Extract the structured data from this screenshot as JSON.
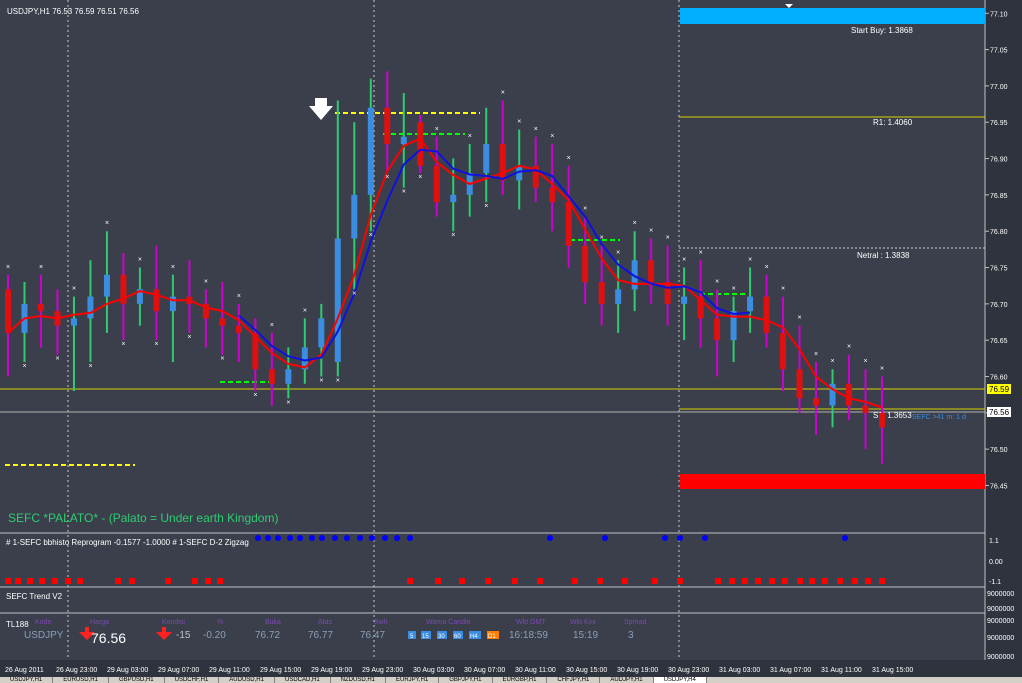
{
  "window": {
    "symbol_header": "USDJPY,H1 76.53 76.59 76.51 76.56"
  },
  "colors": {
    "background": "#3a3f4b",
    "bull": "#3a8de0",
    "bear": "#e01010",
    "wick_bull": "#2ecc71",
    "wick_bear": "#d000d0",
    "ma_red": "#ff0000",
    "ma_blue": "#0000ff",
    "level_yellow": "#ffff00",
    "level_green": "#00ff00",
    "start_buy_bar": "#00b0ff",
    "sell_bar": "#ff0000"
  },
  "price_axis": {
    "ticks": [
      "77.10",
      "77.05",
      "77.00",
      "76.95",
      "76.90",
      "76.85",
      "76.80",
      "76.75",
      "76.70",
      "76.65",
      "76.60",
      "76.55",
      "76.50",
      "76.45"
    ],
    "current_tag": "76.56",
    "level_tag": "76.59"
  },
  "levels": {
    "start_buy": "Start Buy: 1.3868",
    "r1": "R1: 1.4060",
    "netral": "Netral  : 1.3838",
    "s1": "S1: 1.3653",
    "sefc_note": "SEFC >41 m: 1 d"
  },
  "main_label": "SEFC *PALATO* - (Palato = Under earth Kingdom)",
  "sub1": {
    "title": "# 1-SEFC bbhisto Reprogram -0.1577 -1.0000  # 1-SEFC D-2 Zigzag",
    "axis": [
      "1.1",
      "0.00",
      "-1.1"
    ]
  },
  "sub2": {
    "title": "SEFC Trend V2",
    "axis": [
      "9000000",
      "9000000"
    ]
  },
  "sub3": {
    "title": "TL188",
    "axis": [
      "9000000",
      "9000000",
      "9000000"
    ],
    "headers": [
      "Kode",
      "Harga",
      "Kondisi",
      "%",
      "Buka",
      "Atas",
      "Bwh",
      "Warna Candle",
      "Wkt GMT",
      "Wkt Kini",
      "Spread"
    ],
    "symbol": "USDJPY",
    "price": "76.56",
    "kondisi": "-15",
    "percent": "-0.20",
    "buka": "76.72",
    "atas": "76.77",
    "bwh": "76.47",
    "tf": [
      "5",
      "15",
      "30",
      "60",
      "H4",
      "D1"
    ],
    "gmt": "16:18:59",
    "kini": "15:19",
    "spread": "3"
  },
  "time_axis": [
    "26 Aug 2011",
    "26 Aug 23:00",
    "29 Aug 03:00",
    "29 Aug 07:00",
    "29 Aug 11:00",
    "29 Aug 15:00",
    "29 Aug 19:00",
    "29 Aug 23:00",
    "30 Aug 03:00",
    "30 Aug 07:00",
    "30 Aug 11:00",
    "30 Aug 15:00",
    "30 Aug 19:00",
    "30 Aug 23:00",
    "31 Aug 03:00",
    "31 Aug 07:00",
    "31 Aug 11:00",
    "31 Aug 15:00"
  ],
  "bottom_tabs": [
    "USDJPY,H1",
    "EURUSD,H1",
    "GBPUSD,H1",
    "USDCHF,H1",
    "AUDUSD,H1",
    "USDCAD,H1",
    "NZDUSD,H1",
    "EURJPY,H1",
    "GBPJPY,H1",
    "EURGBP,H1",
    "CHFJPY,H1",
    "AUDJPY,H1",
    "USDJPY,H4"
  ],
  "chart_data": {
    "type": "candlestick",
    "ylim": [
      76.43,
      77.11
    ],
    "candles": [
      [
        76.72,
        76.74,
        76.6,
        76.66
      ],
      [
        76.66,
        76.73,
        76.62,
        76.7
      ],
      [
        76.7,
        76.74,
        76.64,
        76.69
      ],
      [
        76.69,
        76.72,
        76.63,
        76.67
      ],
      [
        76.67,
        76.71,
        76.58,
        76.68
      ],
      [
        76.68,
        76.76,
        76.62,
        76.71
      ],
      [
        76.71,
        76.8,
        76.66,
        76.74
      ],
      [
        76.74,
        76.77,
        76.65,
        76.7
      ],
      [
        76.7,
        76.75,
        76.67,
        76.72
      ],
      [
        76.72,
        76.78,
        76.65,
        76.69
      ],
      [
        76.69,
        76.74,
        76.62,
        76.71
      ],
      [
        76.71,
        76.76,
        76.66,
        76.7
      ],
      [
        76.7,
        76.72,
        76.64,
        76.68
      ],
      [
        76.68,
        76.73,
        76.63,
        76.67
      ],
      [
        76.67,
        76.7,
        76.62,
        76.66
      ],
      [
        76.66,
        76.68,
        76.58,
        76.61
      ],
      [
        76.61,
        76.66,
        76.56,
        76.59
      ],
      [
        76.59,
        76.64,
        76.57,
        76.61
      ],
      [
        76.61,
        76.68,
        76.59,
        76.64
      ],
      [
        76.64,
        76.7,
        76.6,
        76.68
      ],
      [
        76.62,
        76.98,
        76.6,
        76.79
      ],
      [
        76.79,
        76.95,
        76.72,
        76.85
      ],
      [
        76.85,
        77.01,
        76.8,
        76.97
      ],
      [
        76.97,
        77.02,
        76.88,
        76.92
      ],
      [
        76.92,
        76.99,
        76.86,
        76.93
      ],
      [
        76.95,
        76.96,
        76.88,
        76.89
      ],
      [
        76.89,
        76.93,
        76.82,
        76.84
      ],
      [
        76.84,
        76.9,
        76.8,
        76.85
      ],
      [
        76.85,
        76.92,
        76.82,
        76.88
      ],
      [
        76.88,
        76.97,
        76.84,
        76.92
      ],
      [
        76.92,
        76.98,
        76.85,
        76.87
      ],
      [
        76.87,
        76.94,
        76.83,
        76.89
      ],
      [
        76.89,
        76.93,
        76.84,
        76.86
      ],
      [
        76.86,
        76.92,
        76.8,
        76.84
      ],
      [
        76.84,
        76.89,
        76.75,
        76.78
      ],
      [
        76.78,
        76.82,
        76.7,
        76.73
      ],
      [
        76.73,
        76.78,
        76.67,
        76.7
      ],
      [
        76.7,
        76.76,
        76.66,
        76.72
      ],
      [
        76.72,
        76.8,
        76.69,
        76.76
      ],
      [
        76.76,
        76.79,
        76.7,
        76.73
      ],
      [
        76.73,
        76.78,
        76.67,
        76.7
      ],
      [
        76.7,
        76.75,
        76.65,
        76.71
      ],
      [
        76.71,
        76.76,
        76.64,
        76.68
      ],
      [
        76.68,
        76.72,
        76.6,
        76.65
      ],
      [
        76.65,
        76.71,
        76.62,
        76.69
      ],
      [
        76.69,
        76.75,
        76.66,
        76.71
      ],
      [
        76.71,
        76.74,
        76.64,
        76.66
      ],
      [
        76.66,
        76.71,
        76.58,
        76.61
      ],
      [
        76.61,
        76.67,
        76.55,
        76.57
      ],
      [
        76.57,
        76.62,
        76.52,
        76.56
      ],
      [
        76.56,
        76.61,
        76.53,
        76.59
      ],
      [
        76.59,
        76.63,
        76.54,
        76.56
      ],
      [
        76.56,
        76.61,
        76.5,
        76.55
      ],
      [
        76.55,
        76.6,
        76.48,
        76.53
      ]
    ]
  }
}
